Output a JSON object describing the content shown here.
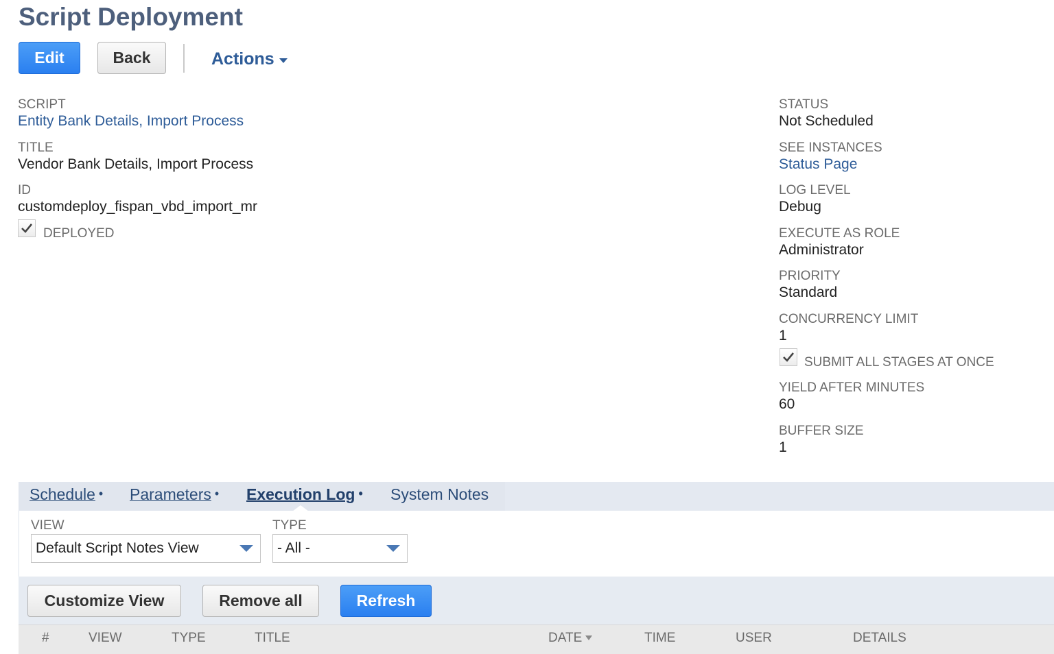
{
  "header": {
    "title": "Script Deployment",
    "edit_label": "Edit",
    "back_label": "Back",
    "actions_label": "Actions"
  },
  "left_fields": {
    "script_label": "SCRIPT",
    "script_value": "Entity Bank Details, Import Process",
    "title_label": "TITLE",
    "title_value": "Vendor Bank Details, Import Process",
    "id_label": "ID",
    "id_value": "customdeploy_fispan_vbd_import_mr",
    "deployed_label": "DEPLOYED",
    "deployed_checked": true
  },
  "right_fields": {
    "status_label": "STATUS",
    "status_value": "Not Scheduled",
    "see_instances_label": "SEE INSTANCES",
    "see_instances_value": "Status Page",
    "log_level_label": "LOG LEVEL",
    "log_level_value": "Debug",
    "execute_as_role_label": "EXECUTE AS ROLE",
    "execute_as_role_value": "Administrator",
    "priority_label": "PRIORITY",
    "priority_value": "Standard",
    "concurrency_limit_label": "CONCURRENCY LIMIT",
    "concurrency_limit_value": "1",
    "submit_all_label": "SUBMIT ALL STAGES AT ONCE",
    "submit_all_checked": true,
    "yield_label": "YIELD AFTER MINUTES",
    "yield_value": "60",
    "buffer_label": "BUFFER SIZE",
    "buffer_value": "1"
  },
  "tabs": [
    {
      "label": "Schedule",
      "dot": "•"
    },
    {
      "label": "Parameters",
      "dot": "•"
    },
    {
      "label": "Execution Log",
      "dot": "•",
      "active": true
    },
    {
      "label": "System Notes",
      "dot": ""
    }
  ],
  "filters": {
    "view_label": "VIEW",
    "view_value": "Default Script Notes View",
    "type_label": "TYPE",
    "type_value": "- All -"
  },
  "list_buttons": {
    "customize_view": "Customize View",
    "remove_all": "Remove all",
    "refresh": "Refresh"
  },
  "table": {
    "columns": [
      "#",
      "VIEW",
      "TYPE",
      "TITLE",
      "DATE",
      "TIME",
      "USER",
      "DETAILS"
    ],
    "sort_column": "DATE"
  },
  "colors": {
    "primary_button": "#2a7ff0",
    "link": "#2e5c98",
    "title": "#4d5f7c",
    "tab_bar": "#e4e9f1"
  }
}
